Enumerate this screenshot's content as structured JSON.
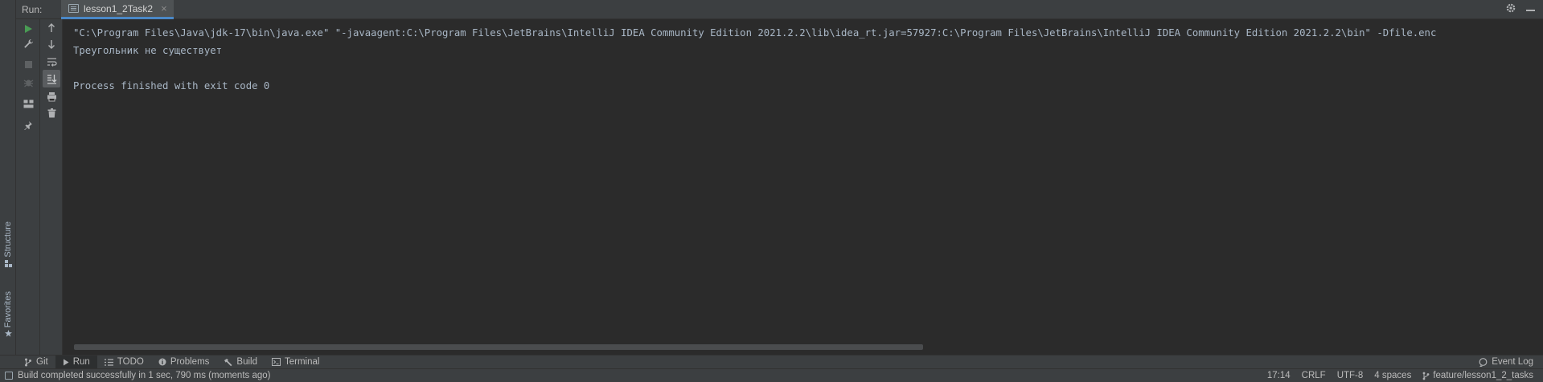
{
  "header": {
    "run_label": "Run:",
    "tab_label": "lesson1_2Task2",
    "tab_close": "×"
  },
  "console": {
    "lines": [
      "\"C:\\Program Files\\Java\\jdk-17\\bin\\java.exe\" \"-javaagent:C:\\Program Files\\JetBrains\\IntelliJ IDEA Community Edition 2021.2.2\\lib\\idea_rt.jar=57927:C:\\Program Files\\JetBrains\\IntelliJ IDEA Community Edition 2021.2.2\\bin\" -Dfile.enc",
      "Треугольник не существует",
      "",
      "Process finished with exit code 0"
    ]
  },
  "side_tabs": {
    "structure": "Structure",
    "favorites": "Favorites"
  },
  "bottom_tools": {
    "git": "Git",
    "run": "Run",
    "todo": "TODO",
    "problems": "Problems",
    "build": "Build",
    "terminal": "Terminal",
    "event_log": "Event Log"
  },
  "status": {
    "message": "Build completed successfully in 1 sec, 790 ms (moments ago)",
    "position": "17:14",
    "line_separator": "CRLF",
    "encoding": "UTF-8",
    "indent": "4 spaces",
    "branch": "feature/lesson1_2_tasks"
  },
  "colors": {
    "background": "#2b2b2b",
    "panel": "#3c3f41",
    "run_green": "#499c54",
    "accent_blue": "#4a88c7",
    "console_text": "#a9b7c6"
  }
}
